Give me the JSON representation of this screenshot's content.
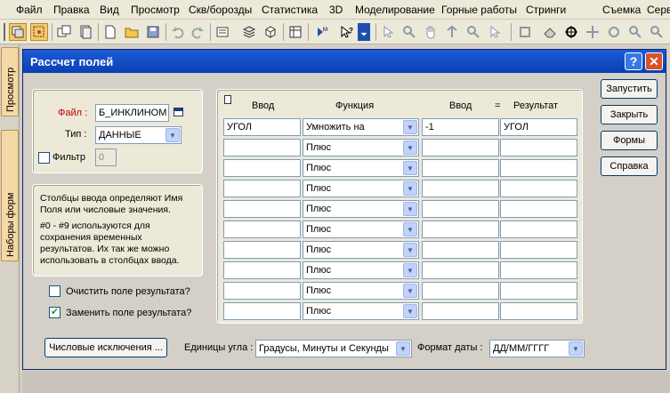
{
  "menu": [
    "Файл",
    "Правка",
    "Вид",
    "Просмотр",
    "Скв/борозды",
    "Статистика",
    "3D",
    "Моделирование",
    "Горные работы",
    "Стринги",
    "Съемка",
    "Сервис"
  ],
  "sidepanel": {
    "tab_preview": "Просмотр",
    "tab_form_sets": "Наборы форм"
  },
  "dialog": {
    "title": "Рассчет полей",
    "help_label": "?",
    "close_label": "✕",
    "file_label": "Файл :",
    "file_value": "Б_ИНКЛИНОМ",
    "type_label": "Тип :",
    "type_value": "ДАННЫЕ",
    "filter_label": "Фильтр",
    "filter_value": "0",
    "info_text_1": "Столбцы ввода определяют Имя Поля или числовые значения.",
    "info_text_2": "#0 - #9 используются для сохранения временных результатов. Их так же можно использовать в столбцах ввода.",
    "clear_result_label": "Очистить поле результата?",
    "clear_result_checked": false,
    "replace_result_label": "Заменить поле результата?",
    "replace_result_checked": true,
    "numeric_exceptions_label": "Числовые исключения ...",
    "angle_units_label": "Единицы угла :",
    "angle_units_value": "Градусы, Минуты и Секунды",
    "date_format_label": "Формат даты :",
    "date_format_value": "ДД/ММ/ГГГГ",
    "buttons": {
      "run": "Запустить",
      "close": "Закрыть",
      "forms": "Формы",
      "help": "Справка"
    },
    "table": {
      "headers": {
        "input1": "Ввод",
        "function": "Функция",
        "input2": "Ввод",
        "equals": "=",
        "result": "Результат"
      },
      "rows": [
        {
          "input1": "УГОЛ",
          "function": "Умножить на",
          "input2": "-1",
          "result": "УГОЛ"
        },
        {
          "input1": "",
          "function": "Плюс",
          "input2": "",
          "result": ""
        },
        {
          "input1": "",
          "function": "Плюс",
          "input2": "",
          "result": ""
        },
        {
          "input1": "",
          "function": "Плюс",
          "input2": "",
          "result": ""
        },
        {
          "input1": "",
          "function": "Плюс",
          "input2": "",
          "result": ""
        },
        {
          "input1": "",
          "function": "Плюс",
          "input2": "",
          "result": ""
        },
        {
          "input1": "",
          "function": "Плюс",
          "input2": "",
          "result": ""
        },
        {
          "input1": "",
          "function": "Плюс",
          "input2": "",
          "result": ""
        },
        {
          "input1": "",
          "function": "Плюс",
          "input2": "",
          "result": ""
        },
        {
          "input1": "",
          "function": "Плюс",
          "input2": "",
          "result": ""
        }
      ]
    }
  }
}
